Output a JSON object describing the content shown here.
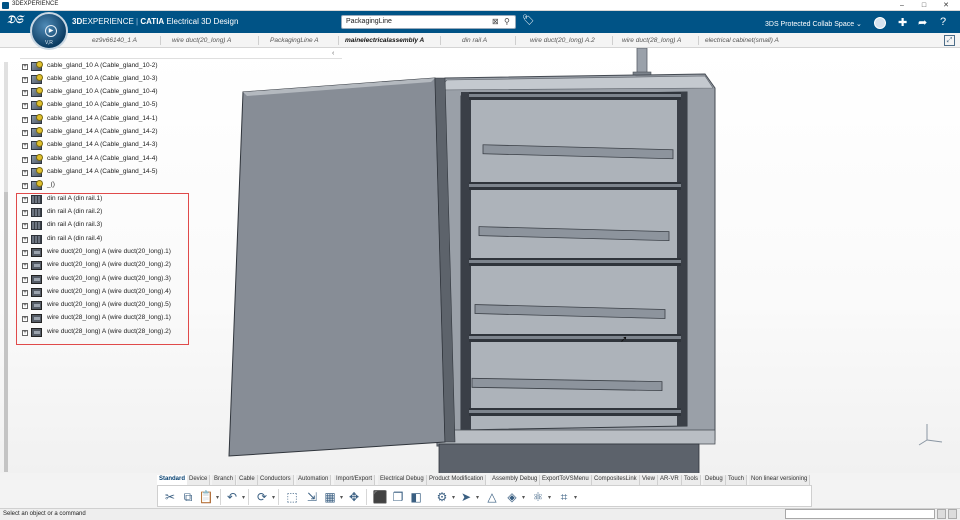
{
  "window": {
    "title": "3DEXPERIENCE",
    "controls": [
      "–",
      "□",
      "✕"
    ]
  },
  "header": {
    "brand_bold": "3D",
    "brand_rest": "EXPERIENCE",
    "separator": " | ",
    "brand_app": "CATIA",
    "app_name": " Electrical 3D Design",
    "compass_version": "V,R",
    "search_value": "PackagingLine",
    "collab_space": "3DS Protected Collab Space",
    "icons": [
      "user-avatar",
      "plus-icon",
      "share-icon",
      "help-icon"
    ]
  },
  "tabs": [
    {
      "label": "ez9v66140_1 A",
      "active": false
    },
    {
      "label": "wire duct(20_long) A",
      "active": false
    },
    {
      "label": "PackagingLine A",
      "active": false
    },
    {
      "label": "mainelectricalassembly A",
      "active": true
    },
    {
      "label": "din rail A",
      "active": false
    },
    {
      "label": "wire duct(20_long) A.2",
      "active": false
    },
    {
      "label": "wire duct(28_long) A",
      "active": false
    },
    {
      "label": "electrical cabinet(small) A",
      "active": false
    }
  ],
  "tree": {
    "nodes": [
      {
        "label": "cable_gland_10 A (Cable_gland_10-2)",
        "icon": "gland"
      },
      {
        "label": "cable_gland_10 A (Cable_gland_10-3)",
        "icon": "gland"
      },
      {
        "label": "cable_gland_10 A (Cable_gland_10-4)",
        "icon": "gland"
      },
      {
        "label": "cable_gland_10 A (Cable_gland_10-5)",
        "icon": "gland"
      },
      {
        "label": "cable_gland_14 A (Cable_gland_14-1)",
        "icon": "gland"
      },
      {
        "label": "cable_gland_14 A (Cable_gland_14-2)",
        "icon": "gland"
      },
      {
        "label": "cable_gland_14 A (Cable_gland_14-3)",
        "icon": "gland"
      },
      {
        "label": "cable_gland_14 A (Cable_gland_14-4)",
        "icon": "gland"
      },
      {
        "label": "cable_gland_14 A (Cable_gland_14-5)",
        "icon": "gland"
      },
      {
        "label": "_()",
        "icon": "gland"
      },
      {
        "label": "din rail A (din rail.1)",
        "icon": "rail"
      },
      {
        "label": "din rail A (din rail.2)",
        "icon": "rail"
      },
      {
        "label": "din rail A (din rail.3)",
        "icon": "rail"
      },
      {
        "label": "din rail A (din rail.4)",
        "icon": "rail"
      },
      {
        "label": "wire duct(20_long) A (wire duct(20_long).1)",
        "icon": "duct"
      },
      {
        "label": "wire duct(20_long) A (wire duct(20_long).2)",
        "icon": "duct"
      },
      {
        "label": "wire duct(20_long) A (wire duct(20_long).3)",
        "icon": "duct"
      },
      {
        "label": "wire duct(20_long) A (wire duct(20_long).4)",
        "icon": "duct"
      },
      {
        "label": "wire duct(20_long) A (wire duct(20_long).5)",
        "icon": "duct"
      },
      {
        "label": "wire duct(28_long) A (wire duct(28_long).1)",
        "icon": "duct"
      },
      {
        "label": "wire duct(28_long) A (wire duct(28_long).2)",
        "icon": "duct"
      }
    ]
  },
  "command_tabs": [
    {
      "label": "Standard",
      "active": true
    },
    {
      "label": "Device",
      "active": false
    },
    {
      "label": "Branch",
      "active": false
    },
    {
      "label": "Cable",
      "active": false
    },
    {
      "label": "Conductors",
      "active": false
    },
    {
      "label": "Automation",
      "active": false
    },
    {
      "label": "Import/Export",
      "active": false
    },
    {
      "label": "Electrical Debug",
      "active": false
    },
    {
      "label": "Product Modification",
      "active": false
    },
    {
      "label": "Assembly Debug",
      "active": false
    },
    {
      "label": "ExportToVSMenu",
      "active": false
    },
    {
      "label": "CompositesLink",
      "active": false
    },
    {
      "label": "View",
      "active": false
    },
    {
      "label": "AR-VR",
      "active": false
    },
    {
      "label": "Tools",
      "active": false
    },
    {
      "label": "Debug",
      "active": false
    },
    {
      "label": "Touch",
      "active": false
    },
    {
      "label": "Non linear versioning",
      "active": false
    }
  ],
  "toolbar_icons": [
    {
      "name": "cut-icon",
      "glyph": "✂",
      "dropdown": false
    },
    {
      "name": "copy-icon",
      "glyph": "⧉",
      "dropdown": false
    },
    {
      "name": "paste-icon",
      "glyph": "📋",
      "dropdown": true
    },
    {
      "name": "undo-icon",
      "glyph": "↶",
      "dropdown": true
    },
    {
      "name": "update-icon",
      "glyph": "⟳",
      "dropdown": true
    },
    {
      "name": "select-icon",
      "glyph": "⬚",
      "dropdown": false
    },
    {
      "name": "select-mode-icon",
      "glyph": "⇲",
      "dropdown": false
    },
    {
      "name": "table-icon",
      "glyph": "▦",
      "dropdown": true
    },
    {
      "name": "move-icon",
      "glyph": "✥",
      "dropdown": false
    },
    {
      "name": "box-icon",
      "glyph": "⬛",
      "dropdown": false
    },
    {
      "name": "multi-box-icon",
      "glyph": "❐",
      "dropdown": false
    },
    {
      "name": "measure-icon",
      "glyph": "◧",
      "dropdown": false
    },
    {
      "name": "assembly-icon",
      "glyph": "⚙",
      "dropdown": true
    },
    {
      "name": "fly-icon",
      "glyph": "➤",
      "dropdown": true
    },
    {
      "name": "compass-tool-icon",
      "glyph": "△",
      "dropdown": false
    },
    {
      "name": "section-icon",
      "glyph": "◈",
      "dropdown": true
    },
    {
      "name": "clash-icon",
      "glyph": "⚛",
      "dropdown": true
    },
    {
      "name": "capture-icon",
      "glyph": "⌗",
      "dropdown": true
    }
  ],
  "status": {
    "prompt": "Select an object or a command",
    "command_input": ""
  },
  "colors": {
    "brand_blue": "#005386",
    "highlight_red": "#e04a4a",
    "cabinet_gray": "#8d949e",
    "cabinet_dark": "#5f6670"
  }
}
